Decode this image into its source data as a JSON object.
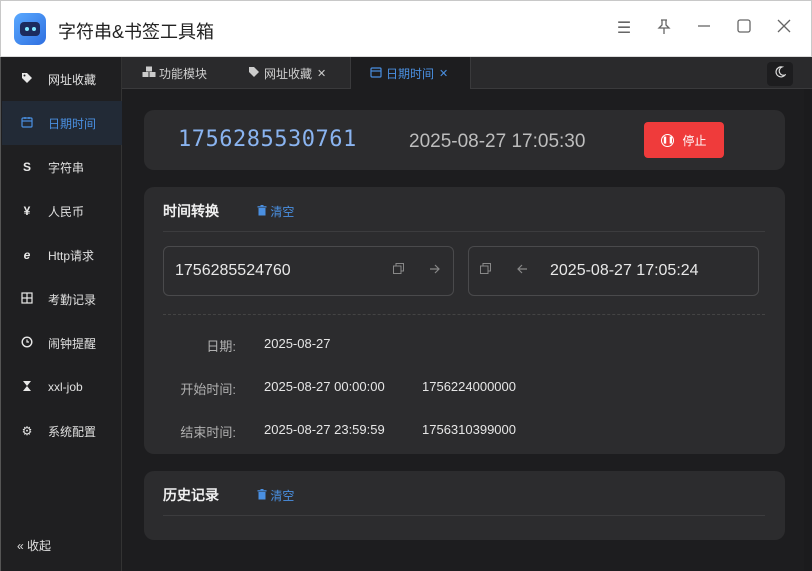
{
  "app": {
    "title": "字符串&书签工具箱"
  },
  "window_controls": [
    "menu-icon",
    "pin-icon",
    "minimize-icon",
    "maximize-icon",
    "close-icon"
  ],
  "sidebar": {
    "items": [
      {
        "label": "网址收藏",
        "icon": "tag-icon",
        "glyph": "🏷"
      },
      {
        "label": "日期时间",
        "icon": "calendar-icon",
        "glyph": "▦",
        "active": true
      },
      {
        "label": "字符串",
        "icon": "string-icon",
        "glyph": "S"
      },
      {
        "label": "人民币",
        "icon": "yuan-icon",
        "glyph": "¥"
      },
      {
        "label": "Http请求",
        "icon": "browser-icon",
        "glyph": "e"
      },
      {
        "label": "考勤记录",
        "icon": "grid-icon",
        "glyph": "⊞"
      },
      {
        "label": "闹钟提醒",
        "icon": "clock-icon",
        "glyph": "◷"
      },
      {
        "label": "xxl-job",
        "icon": "hourglass-icon",
        "glyph": "⧗"
      },
      {
        "label": "系统配置",
        "icon": "gear-icon",
        "glyph": "⚙"
      }
    ],
    "collapse_label": "« 收起"
  },
  "tabs": [
    {
      "label": "功能模块",
      "icon": "cubes-icon"
    },
    {
      "label": "网址收藏",
      "icon": "tag-icon",
      "closable": true
    },
    {
      "label": "日期时间",
      "icon": "calendar-icon",
      "closable": true,
      "active": true
    }
  ],
  "clock": {
    "timestamp": "1756285530761",
    "datetime": "2025-08-27 17:05:30",
    "stop_label": "停止"
  },
  "convert": {
    "title": "时间转换",
    "clear_label": "清空",
    "input_timestamp": "1756285524760",
    "output_datetime": "2025-08-27 17:05:24",
    "date_label": "日期:",
    "date_value": "2025-08-27",
    "start_label": "开始时间:",
    "start_datetime": "2025-08-27 00:00:00",
    "start_timestamp": "1756224000000",
    "end_label": "结束时间:",
    "end_datetime": "2025-08-27 23:59:59",
    "end_timestamp": "1756310399000"
  },
  "history": {
    "title": "历史记录",
    "clear_label": "清空"
  },
  "colors": {
    "accent": "#4a90e2",
    "danger": "#ef3b3b",
    "background": "#1d1d1f",
    "card": "#2c2c2e"
  }
}
